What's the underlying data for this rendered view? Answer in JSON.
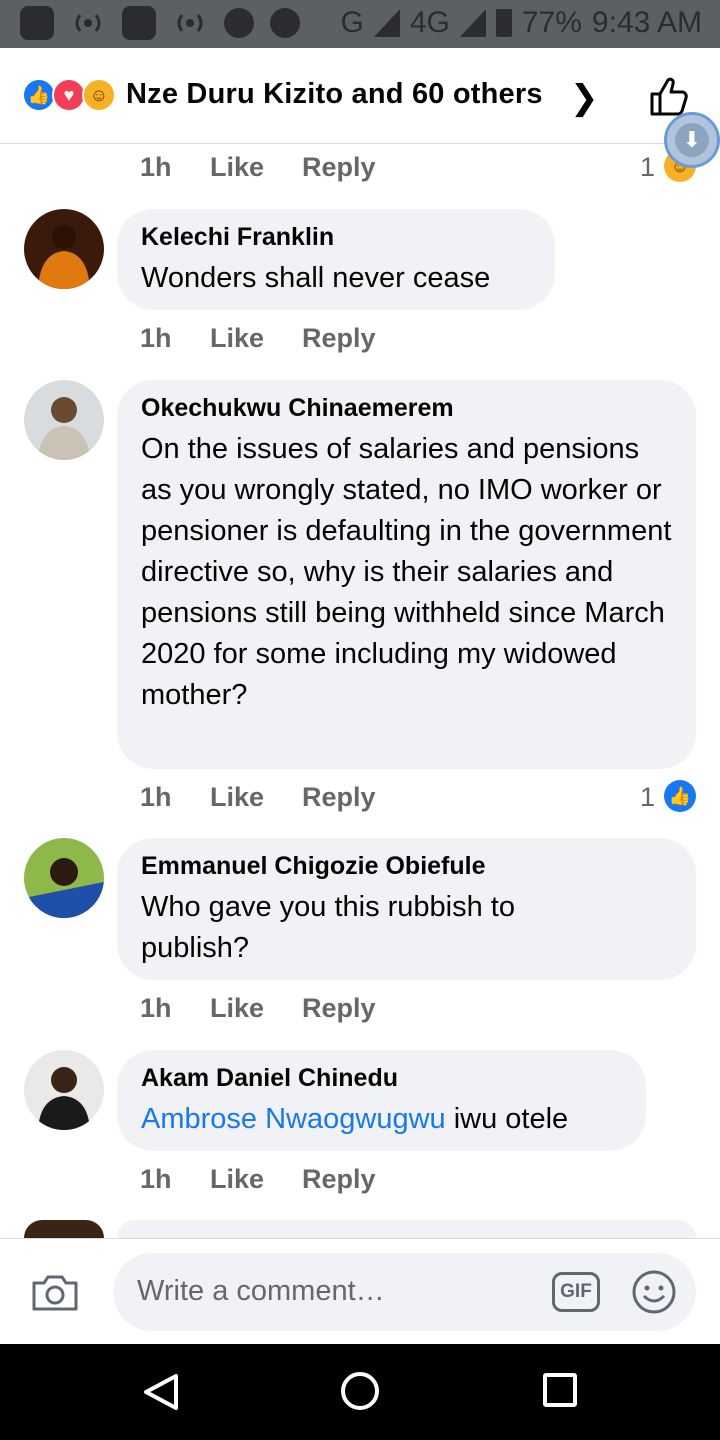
{
  "status_bar": {
    "network": "G",
    "network2": "4G",
    "network2_sup": "4G",
    "battery": "77%",
    "time": "9:43 AM"
  },
  "header": {
    "title": "Nze Duru Kizito and 60 others",
    "reaction_icons": [
      "like-icon",
      "love-icon",
      "haha-icon"
    ]
  },
  "meta_labels": {
    "like": "Like",
    "reply": "Reply"
  },
  "top_meta": {
    "time": "1h",
    "reaction_count": "1"
  },
  "comments": [
    {
      "author": "Kelechi Franklin",
      "text": "Wonders shall never cease",
      "time": "1h"
    },
    {
      "author": "Okechukwu Chinaemerem",
      "text": "On the issues of salaries and pensions as you wrongly stated, no IMO worker or pensioner is defaulting in the government directive so, why is their salaries and pensions still being withheld since March 2020 for some including my widowed mother?",
      "time": "1h",
      "reaction_count": "1"
    },
    {
      "author": "Emmanuel Chigozie Obiefule",
      "text": "Who gave you this rubbish to publish?",
      "time": "1h"
    },
    {
      "author": "Akam Daniel Chinedu",
      "mention": "Ambrose Nwaogwugwu",
      "text": " iwu otele",
      "time": "1h"
    }
  ],
  "composer": {
    "placeholder": "Write a comment…",
    "gif_label": "GIF"
  },
  "colors": {
    "accent": "#1877f2",
    "bubble": "#f0f2f5",
    "muted": "#65676b"
  }
}
